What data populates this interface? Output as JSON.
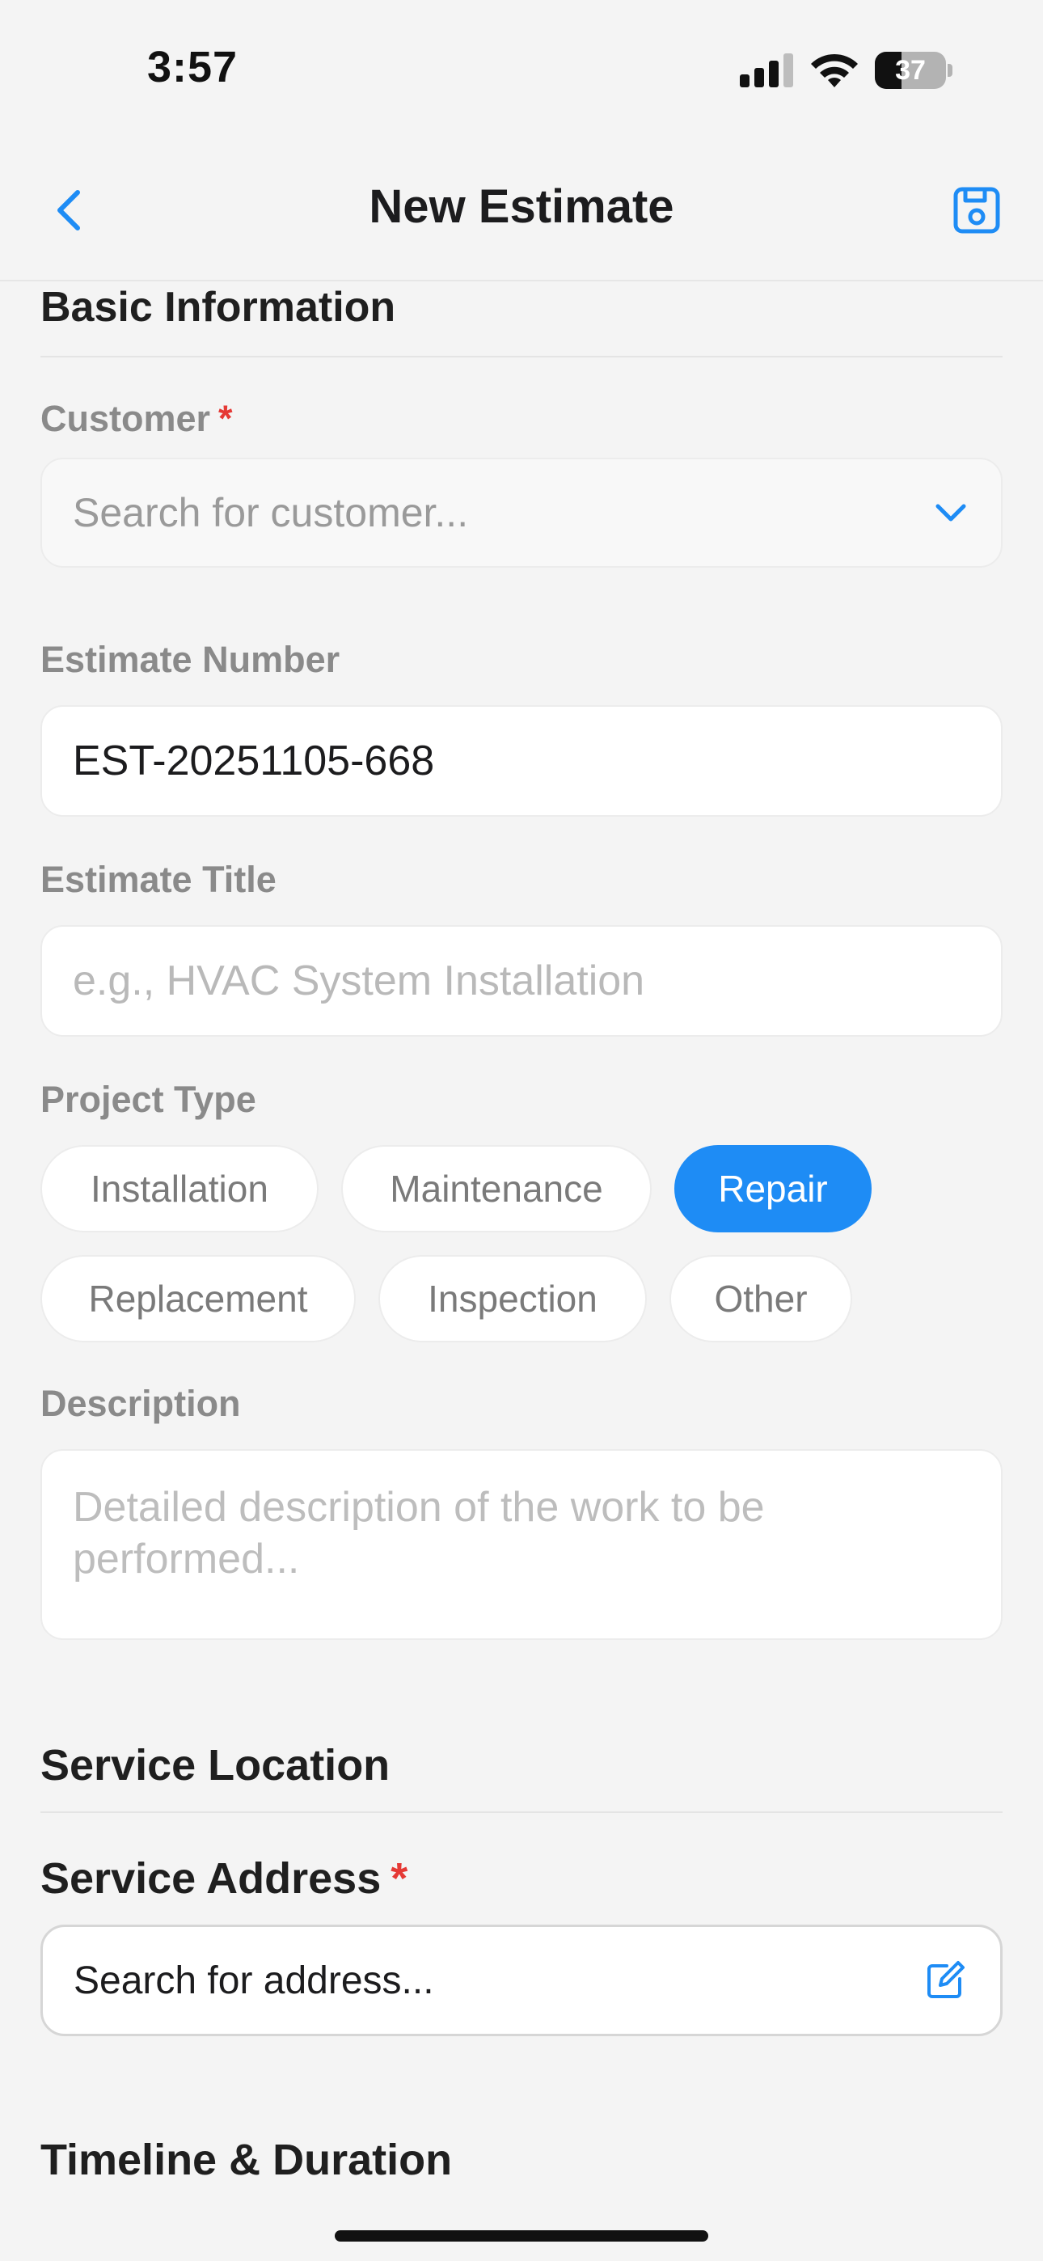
{
  "status_bar": {
    "time": "3:57",
    "battery": "37"
  },
  "nav": {
    "title": "New Estimate"
  },
  "colors": {
    "accent": "#1e8cf5",
    "required": "#e53935",
    "background": "#f4f4f4"
  },
  "icons": {
    "back": "chevron-left-icon",
    "save": "save-icon",
    "dropdown": "chevron-down-icon",
    "edit": "edit-icon"
  },
  "basic_info": {
    "section_title": "Basic Information",
    "customer": {
      "label": "Customer",
      "required_mark": "*",
      "placeholder": "Search for customer..."
    },
    "estimate_number": {
      "label": "Estimate Number",
      "value": "EST-20251105-668"
    },
    "estimate_title": {
      "label": "Estimate Title",
      "placeholder": "e.g., HVAC System Installation"
    },
    "project_type": {
      "label": "Project Type",
      "options": [
        "Installation",
        "Maintenance",
        "Repair",
        "Replacement",
        "Inspection",
        "Other"
      ],
      "selected": "Repair"
    },
    "description": {
      "label": "Description",
      "placeholder": "Detailed description of the work to be performed..."
    }
  },
  "service_location": {
    "section_title": "Service Location",
    "address": {
      "label": "Service Address",
      "required_mark": "*",
      "placeholder": "Search for address..."
    }
  },
  "timeline": {
    "section_title": "Timeline & Duration"
  }
}
